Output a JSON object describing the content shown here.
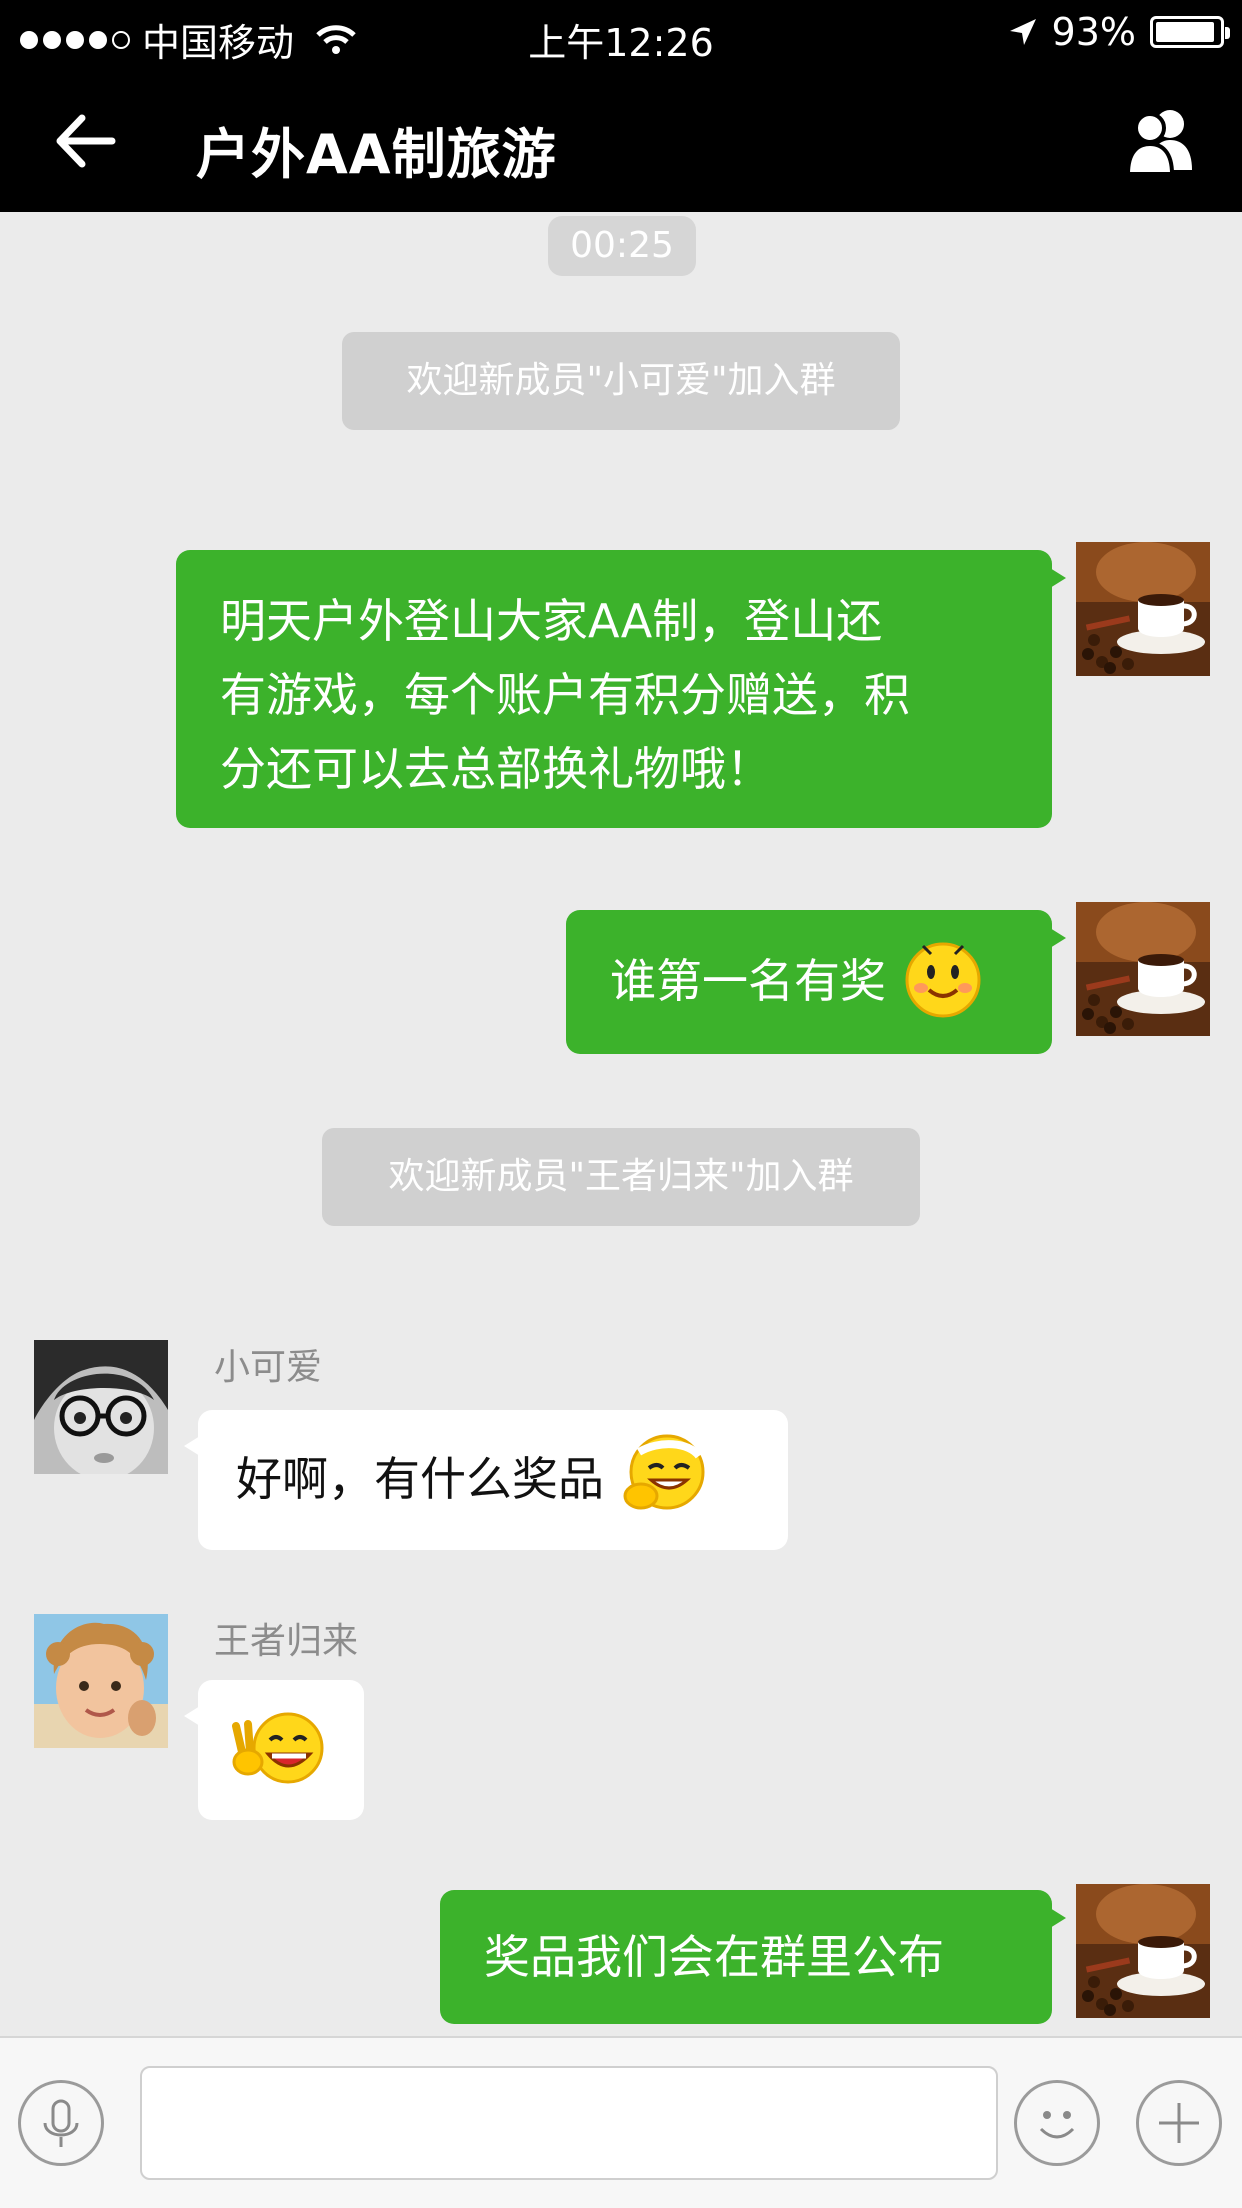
{
  "status_bar": {
    "carrier": "中国移动",
    "time": "上午12:26",
    "battery": "93%",
    "battery_level": 0.93
  },
  "nav": {
    "title": "户外AA制旅游",
    "back_icon": "back-arrow-icon",
    "members_icon": "group-members-icon"
  },
  "chat": {
    "timestamp": "00:25",
    "system_1": "欢迎新成员\"小可爱\"加入群",
    "system_2": "欢迎新成员\"王者归来\"加入群",
    "msg_1": "明天户外登山大家AA制，登山还有游戏，每个账户有积分赠送，积分还可以去总部换礼物哦！",
    "msg_1_lines": [
      "明天户外登山大家AA制，登山还",
      "有游戏，每个账户有积分赠送，积",
      "分还可以去总部换礼物哦！"
    ],
    "msg_2": "谁第一名有奖",
    "sender_1": "小可爱",
    "msg_3": "好啊，有什么奖品",
    "sender_2": "王者归来",
    "msg_5": "奖品我们会在群里公布"
  },
  "input_bar": {
    "voice_icon": "microphone-icon",
    "emoji_icon": "smiley-icon",
    "more_icon": "plus-icon"
  }
}
